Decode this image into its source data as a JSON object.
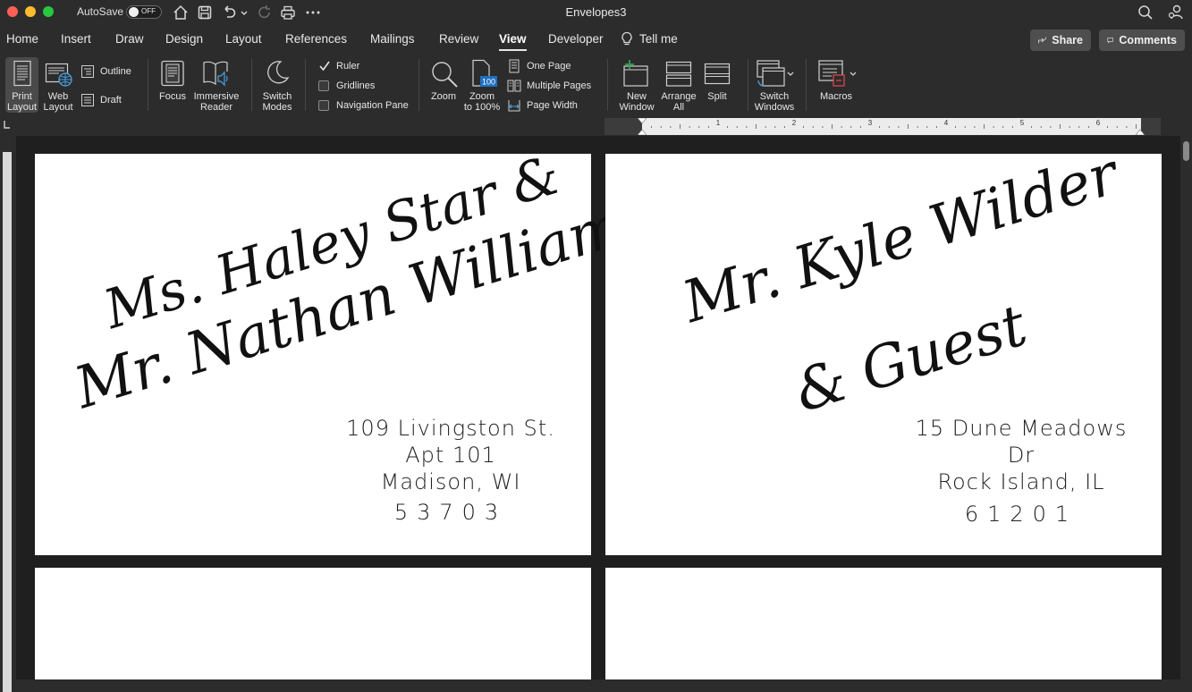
{
  "window": {
    "title": "Envelopes3",
    "autosave_label": "AutoSave",
    "autosave_state": "OFF"
  },
  "tabs": [
    {
      "label": "Home"
    },
    {
      "label": "Insert"
    },
    {
      "label": "Draw"
    },
    {
      "label": "Design"
    },
    {
      "label": "Layout"
    },
    {
      "label": "References"
    },
    {
      "label": "Mailings"
    },
    {
      "label": "Review"
    },
    {
      "label": "View",
      "active": true
    },
    {
      "label": "Developer"
    }
  ],
  "tell_me": "Tell me",
  "share_label": "Share",
  "comments_label": "Comments",
  "ribbon": {
    "print_layout": [
      "Print",
      "Layout"
    ],
    "web_layout": [
      "Web",
      "Layout"
    ],
    "outline": "Outline",
    "draft": "Draft",
    "focus": "Focus",
    "immersive_reader": [
      "Immersive",
      "Reader"
    ],
    "switch_modes": [
      "Switch",
      "Modes"
    ],
    "ruler": {
      "label": "Ruler",
      "checked": true
    },
    "gridlines": {
      "label": "Gridlines",
      "checked": false
    },
    "navigation_pane": {
      "label": "Navigation Pane",
      "checked": false
    },
    "zoom": "Zoom",
    "zoom_100": [
      "Zoom",
      "to 100%"
    ],
    "zoom_100_badge": "100",
    "one_page": "One Page",
    "multiple_pages": "Multiple Pages",
    "page_width": "Page Width",
    "new_window": [
      "New",
      "Window"
    ],
    "arrange_all": [
      "Arrange",
      "All"
    ],
    "split": "Split",
    "switch_windows": [
      "Switch",
      "Windows"
    ],
    "macros": "Macros"
  },
  "ruler_numbers": [
    "1",
    "2",
    "3",
    "4",
    "5",
    "6"
  ],
  "envelopes": [
    {
      "recipient_line1": "Ms. Haley Star &",
      "recipient_line2": "Mr. Nathan Williams",
      "address": [
        "109 Livingston St.",
        "Apt 101",
        "Madison, WI"
      ],
      "zip": "53703"
    },
    {
      "recipient_line1": "Mr. Kyle Wilder",
      "recipient_line2": "& Guest",
      "address": [
        "15 Dune Meadows Dr",
        "Rock Island, IL"
      ],
      "zip": "61201"
    }
  ]
}
